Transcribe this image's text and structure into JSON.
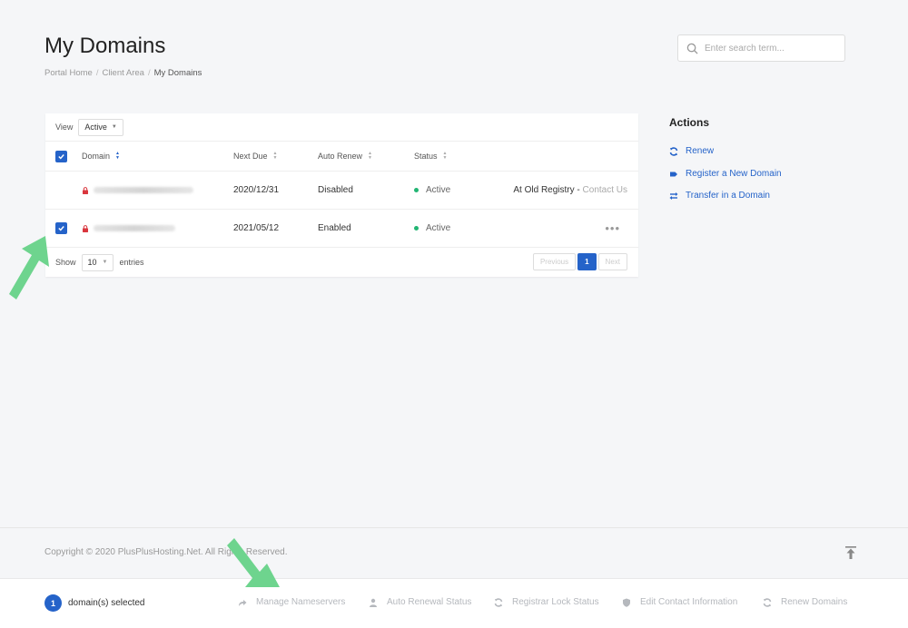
{
  "header": {
    "title": "My Domains",
    "breadcrumb": [
      "Portal Home",
      "Client Area",
      "My Domains"
    ],
    "search_placeholder": "Enter search term..."
  },
  "table": {
    "view_label": "View",
    "view_value": "Active",
    "columns": [
      "Domain",
      "Next Due",
      "Auto Renew",
      "Status"
    ],
    "rows": [
      {
        "checked": false,
        "next_due": "2020/12/31",
        "auto_renew": "Disabled",
        "status": "Active",
        "extra": "At Old Registry - ",
        "extra_link": "Contact Us"
      },
      {
        "checked": true,
        "next_due": "2021/05/12",
        "auto_renew": "Enabled",
        "status": "Active",
        "extra_menu": "•••"
      }
    ],
    "show_label": "Show",
    "entries_value": "10",
    "entries_label": "entries",
    "pager": {
      "previous": "Previous",
      "page": "1",
      "next": "Next"
    }
  },
  "actions": {
    "title": "Actions",
    "items": [
      {
        "label": "Renew",
        "icon": "refresh-icon"
      },
      {
        "label": "Register a New Domain",
        "icon": "tag-icon"
      },
      {
        "label": "Transfer in a Domain",
        "icon": "transfer-icon"
      }
    ]
  },
  "footer": {
    "copyright": "Copyright © 2020 PlusPlusHosting.Net. All Rights Reserved."
  },
  "bulk": {
    "count": "1",
    "selected_label": "domain(s) selected",
    "items": [
      {
        "label": "Manage Nameservers",
        "icon": "share-arrow-icon"
      },
      {
        "label": "Auto Renewal Status",
        "icon": "user-icon"
      },
      {
        "label": "Registrar Lock Status",
        "icon": "refresh-icon"
      },
      {
        "label": "Edit Contact Information",
        "icon": "shield-icon"
      },
      {
        "label": "Renew Domains",
        "icon": "refresh-icon"
      }
    ]
  },
  "colors": {
    "accent": "#2563c9",
    "active_status": "#22b573",
    "annotation_arrow": "#6ed48e"
  }
}
